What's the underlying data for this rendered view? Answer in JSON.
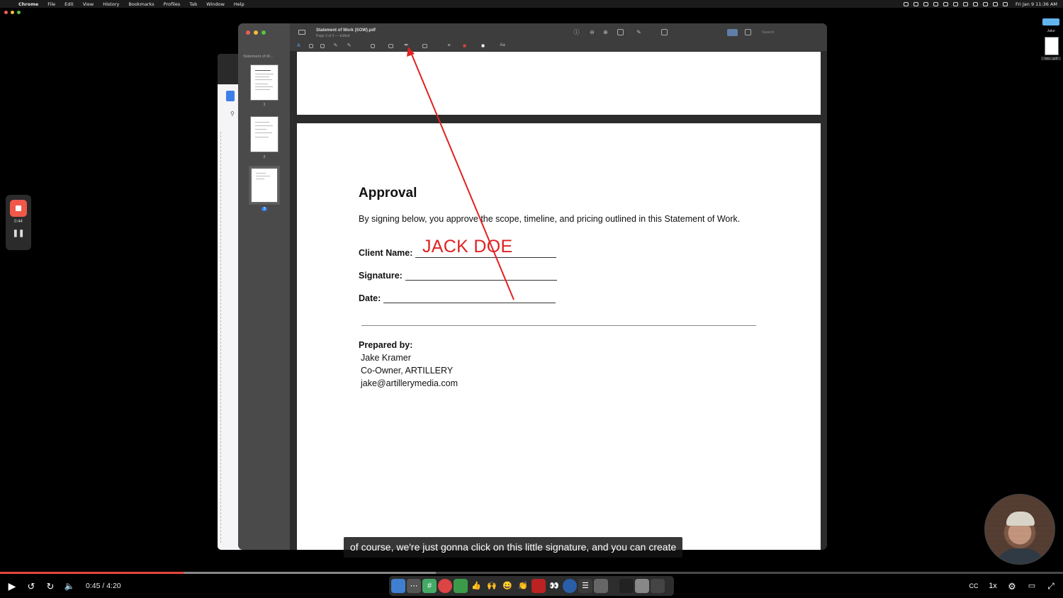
{
  "menubar": {
    "app": "Chrome",
    "items": [
      "File",
      "Edit",
      "View",
      "History",
      "Bookmarks",
      "Profiles",
      "Tab",
      "Window",
      "Help"
    ],
    "clock": "Fri Jan 9  11:36 AM"
  },
  "preview_window": {
    "doc_title": "Statement of Work (SOW).pdf",
    "doc_subtitle": "Page 3 of 3 — Edited",
    "sidebar_title": "Statement of W...",
    "thumbnails": [
      {
        "label": "1",
        "selected": false
      },
      {
        "label": "2",
        "selected": false
      },
      {
        "label": "3",
        "selected": true
      }
    ],
    "search_placeholder": "Search"
  },
  "document": {
    "heading": "Approval",
    "body": "By signing below, you approve the scope, timeline, and pricing outlined in this Statement of Work.",
    "client_label": "Client Name:",
    "client_value": "JACK DOE",
    "signature_label": "Signature:",
    "date_label": "Date:",
    "prepared_label": "Prepared by:",
    "prepared_lines": [
      "Jake Kramer",
      "Co-Owner, ARTILLERY",
      "jake@artillerymedia.com"
    ]
  },
  "right_widget": {
    "label": "Jake",
    "file_label": "Sta....pdf"
  },
  "recorder": {
    "elapsed": "0:44"
  },
  "caption": "of course, we're just gonna click on this little signature, and you can create",
  "player": {
    "time": "0:45 / 4:20",
    "progress": 0.173,
    "buffered": 0.41,
    "speed": "1x"
  },
  "colors": {
    "annotation_red": "#e02222",
    "progress_red": "#e3463a",
    "recorder_orange": "#f0584a"
  }
}
